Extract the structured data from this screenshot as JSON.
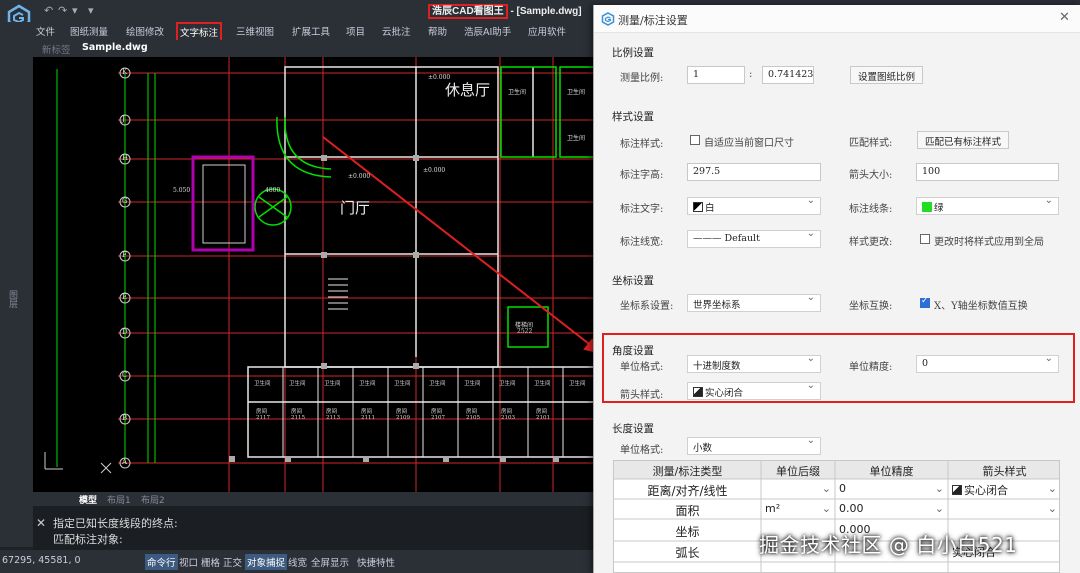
{
  "app": {
    "title_brand": "浩辰CAD看图王",
    "title_rest": " - [Sample.dwg]"
  },
  "menu": {
    "items": [
      {
        "label": "文件"
      },
      {
        "label": "图纸测量"
      },
      {
        "label": "绘图修改"
      },
      {
        "label": "文字标注"
      },
      {
        "label": "三维视图"
      },
      {
        "label": "扩展工具"
      },
      {
        "label": "项目"
      },
      {
        "label": "云批注"
      },
      {
        "label": "帮助"
      },
      {
        "label": "浩辰AI助手"
      },
      {
        "label": "应用软件"
      }
    ]
  },
  "tabs": {
    "items": [
      {
        "label": "新标签"
      },
      {
        "label": "Sample.dwg"
      }
    ]
  },
  "drawing": {
    "room_rest": "休息厅",
    "room_lobby": "门厅",
    "dim_left": "4800",
    "dim_small": "5.050",
    "bay_labels": [
      "卫生间",
      "卫生间",
      "卫生间",
      "卫生间",
      "卫生间",
      "卫生间",
      "卫生间",
      "卫生间",
      "卫生间",
      "卫生间"
    ],
    "room_labels": [
      "房间",
      "房间",
      "房间",
      "房间",
      "房间",
      "房间",
      "房间",
      "房间",
      "房间"
    ],
    "room_nums": [
      "2117",
      "2115",
      "2113",
      "2111",
      "2109",
      "2107",
      "2105",
      "2103",
      "2101"
    ],
    "axis_marks": [
      "K",
      "J",
      "H",
      "G",
      "F",
      "E",
      "D",
      "C",
      "B",
      "A"
    ],
    "stair": "楼梯间",
    "stair_num": "2522",
    "top_labels": [
      "卫生间",
      "卫生间",
      "卫生间"
    ],
    "misc_labels": [
      "±0.000",
      "±0.000",
      "±0.000"
    ]
  },
  "layout_tabs": {
    "items": [
      {
        "label": "模型"
      },
      {
        "label": "布局1"
      },
      {
        "label": "布局2"
      }
    ]
  },
  "command": {
    "line1": "指定已知长度线段的终点:",
    "line2": "匹配标注对象:"
  },
  "leftstrip": {
    "label": "图层"
  },
  "status": {
    "coords": "67295, 45581, 0",
    "items": [
      {
        "label": "命令行"
      },
      {
        "label": "视口"
      },
      {
        "label": "栅格"
      },
      {
        "label": "正交"
      },
      {
        "label": "对象捕捉"
      },
      {
        "label": "线宽"
      },
      {
        "label": "全屏显示"
      },
      {
        "label": "快捷特性"
      }
    ]
  },
  "dialog": {
    "title": "测量/标注设置",
    "scale": {
      "section": "比例设置",
      "label": "测量比例:",
      "value_left": "1",
      "sep": ":",
      "value_right": "0.7414233",
      "button": "设置图纸比例"
    },
    "style": {
      "section": "样式设置",
      "label_style": "标注样式:",
      "autofit": "自适应当前窗口尺寸",
      "label_match": "匹配样式:",
      "match_button": "匹配已有标注样式",
      "label_height": "标注字高:",
      "height_value": "297.5",
      "label_arrow_size": "箭头大小:",
      "arrow_size_value": "100",
      "label_text": "标注文字:",
      "text_value": "白",
      "label_line": "标注线条:",
      "line_value": "绿",
      "label_width": "标注线宽:",
      "width_value": "——— Default",
      "label_change": "样式更改:",
      "change_check": "更改时将样式应用到全局"
    },
    "coord": {
      "section": "坐标设置",
      "label_sys": "坐标系设置:",
      "sys_value": "世界坐标系",
      "label_swap": "坐标互换:",
      "swap_check": "X、Y轴坐标数值互换"
    },
    "angle": {
      "section": "角度设置",
      "label_unit": "单位格式:",
      "unit_value": "十进制度数",
      "label_precision": "单位精度:",
      "precision_value": "0",
      "label_arrow": "箭头样式:",
      "arrow_value": "实心闭合"
    },
    "length": {
      "section": "长度设置",
      "label_unit": "单位格式:",
      "unit_value": "小数"
    },
    "table": {
      "headers": [
        "测量/标注类型",
        "单位后缀",
        "单位精度",
        "箭头样式"
      ],
      "rows": [
        [
          "距离/对齐/线性",
          "",
          "0",
          "实心闭合"
        ],
        [
          "面积",
          "m²",
          "0.00",
          ""
        ],
        [
          "坐标",
          "",
          "0.000",
          ""
        ],
        [
          "弧长",
          "",
          "",
          "实心闭合"
        ]
      ]
    }
  },
  "watermark": "掘金技术社区 @ 白小白521",
  "colors": {
    "highlight_red": "#e02020",
    "canvas_bg": "#000000",
    "line_green": "#00ff00",
    "text_white": "#ffffff"
  }
}
